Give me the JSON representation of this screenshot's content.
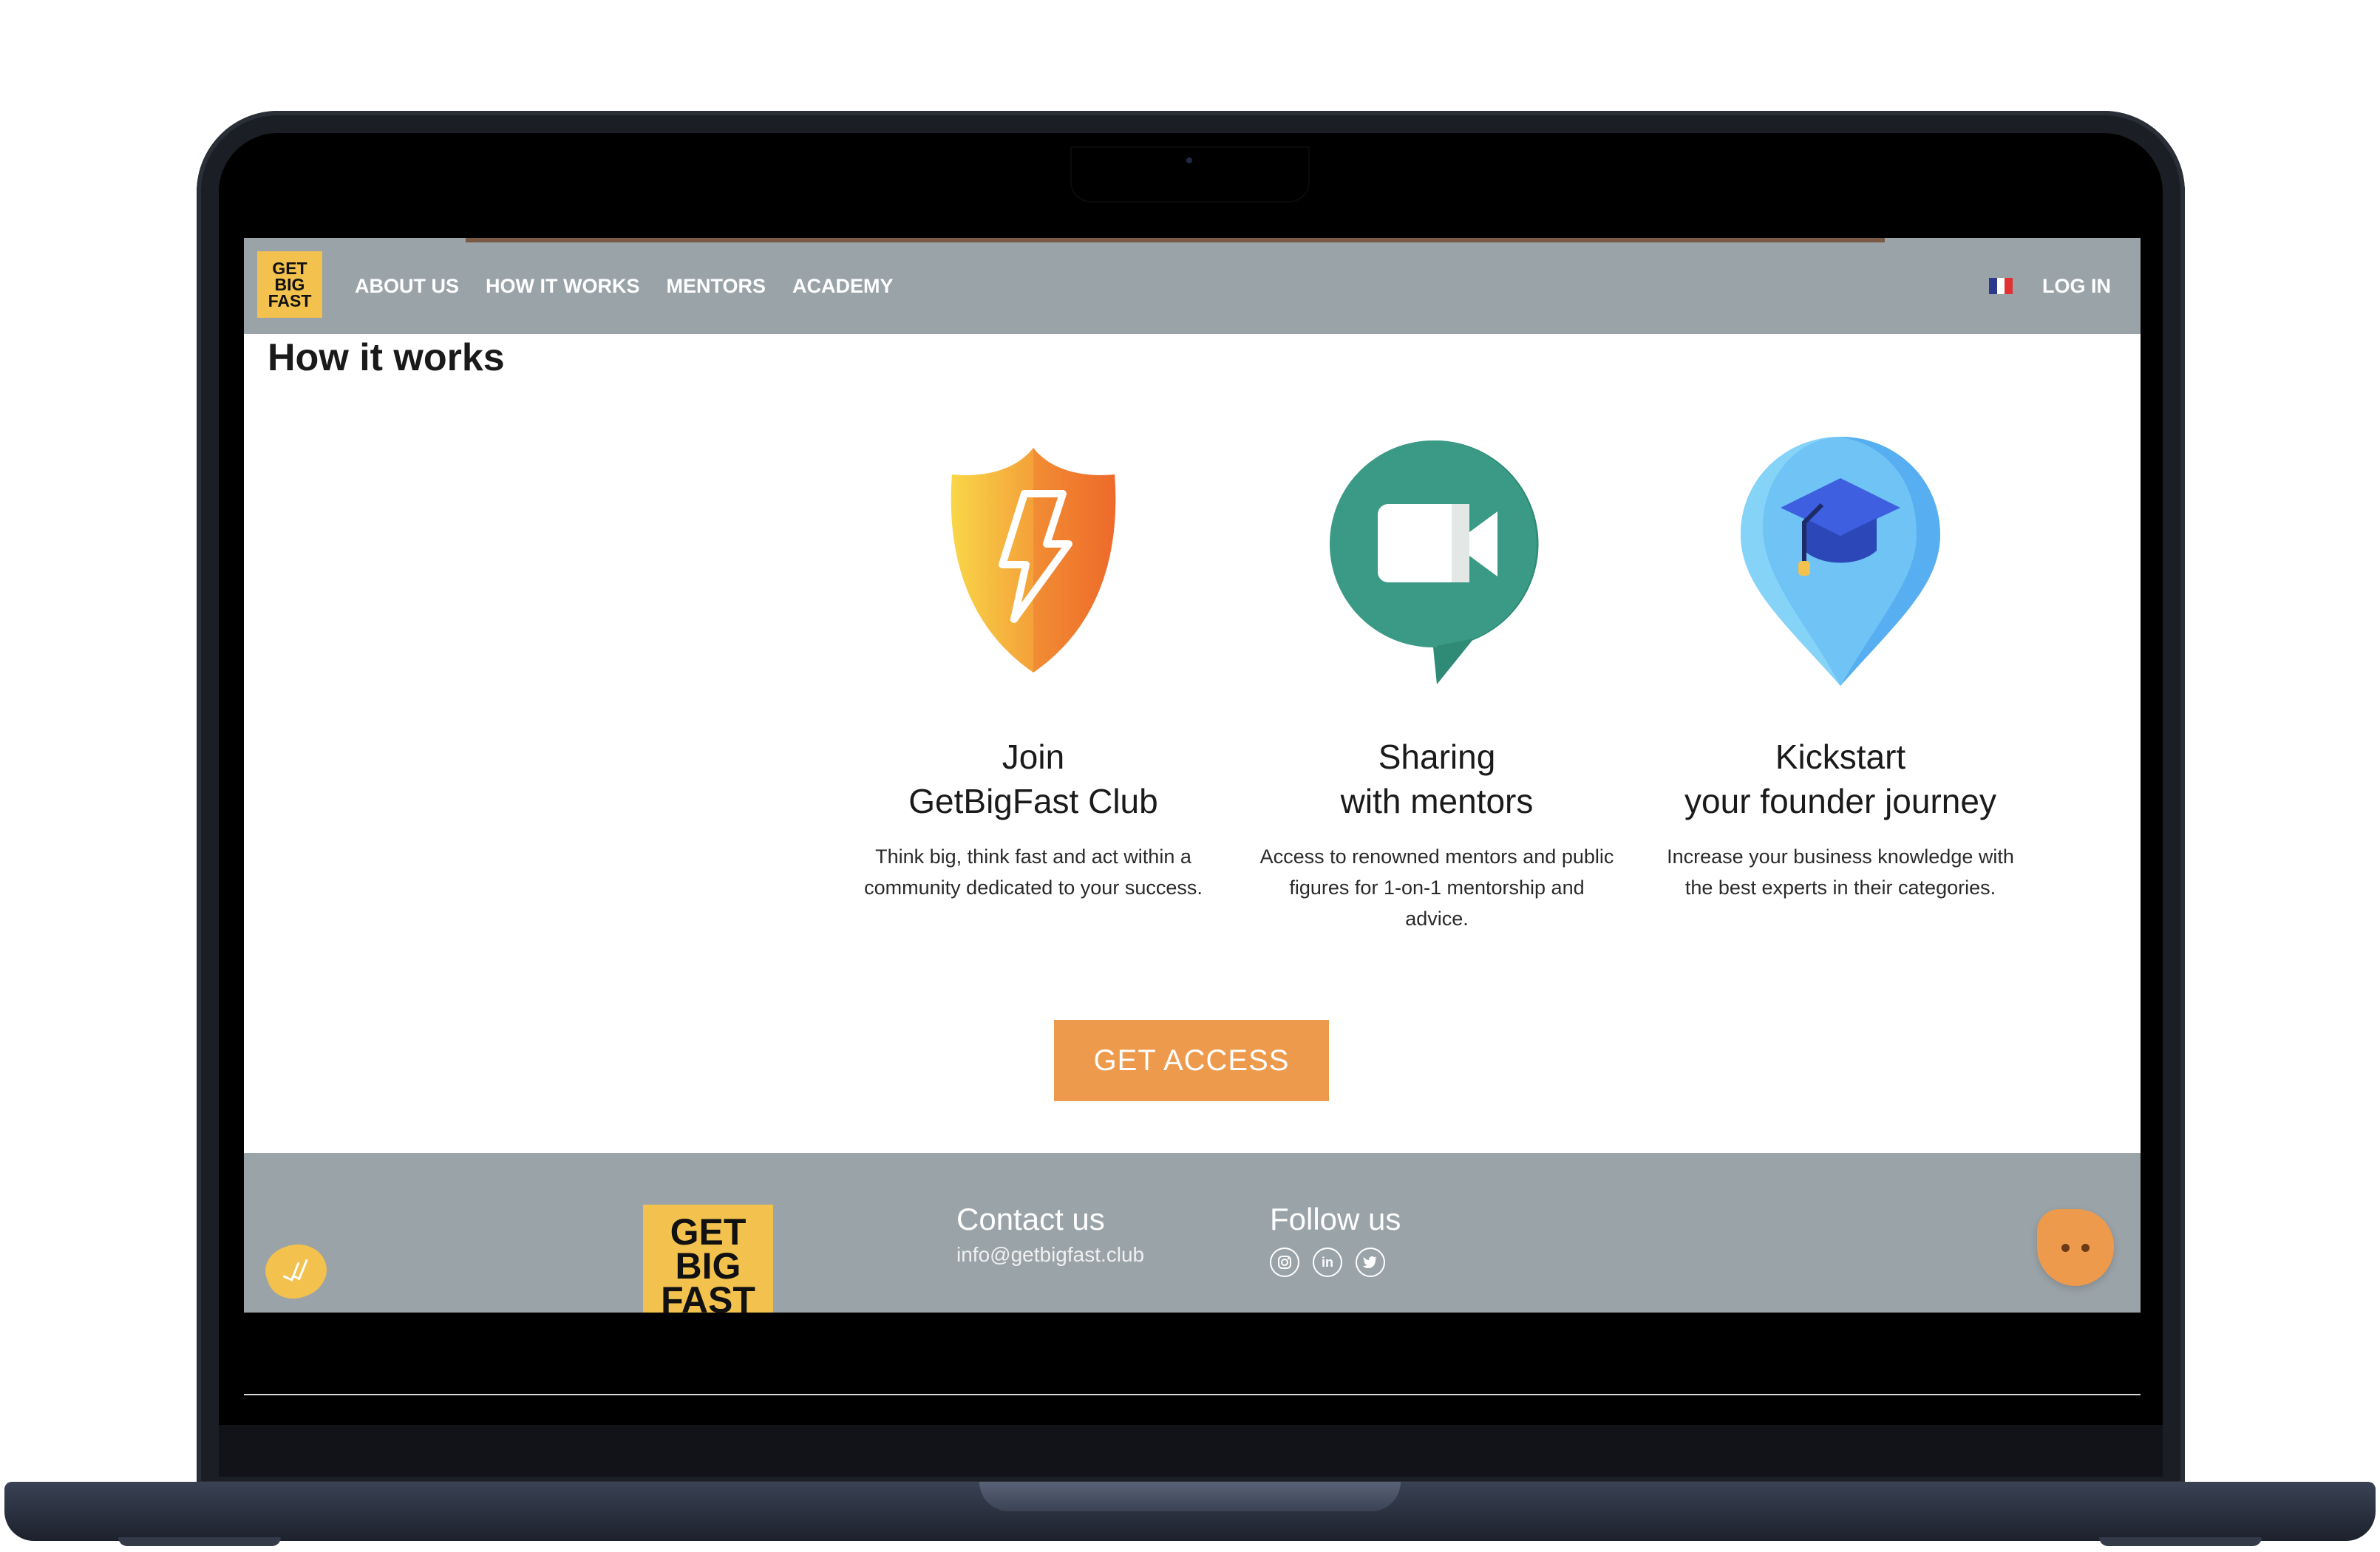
{
  "nav": {
    "logo_lines": [
      "GET",
      "BIG",
      "FAST"
    ],
    "links": [
      "ABOUT US",
      "HOW IT WORKS",
      "MENTORS",
      "ACADEMY"
    ],
    "login": "LOG IN",
    "flag_colors": [
      "#2b3a8c",
      "#ffffff",
      "#e03232"
    ]
  },
  "main": {
    "title": "How it works",
    "features": [
      {
        "icon": "shield-lightning-icon",
        "title_line1": "Join",
        "title_line2": "GetBigFast Club",
        "description": "Think big, think fast and act within a community dedicated to your success."
      },
      {
        "icon": "video-chat-icon",
        "title_line1": "Sharing",
        "title_line2": "with mentors",
        "description": "Access to renowned mentors and public figures for 1-on-1 mentorship and advice."
      },
      {
        "icon": "graduation-pin-icon",
        "title_line1": "Kickstart",
        "title_line2": "your founder journey",
        "description": "Increase your business knowledge with the best experts in their categories."
      }
    ],
    "cta": "GET ACCESS"
  },
  "footer": {
    "logo_lines": [
      "GET",
      "BIG",
      "FAST"
    ],
    "contact_title": "Contact us",
    "contact_email": "info@getbigfast.club",
    "follow_title": "Follow us",
    "social": [
      "instagram-icon",
      "linkedin-icon",
      "twitter-icon"
    ],
    "linkedin_glyph": "in"
  },
  "colors": {
    "nav_bg": "#9aa3a8",
    "accent": "#ee9a4c",
    "logo_yellow": "#f3c14e"
  }
}
